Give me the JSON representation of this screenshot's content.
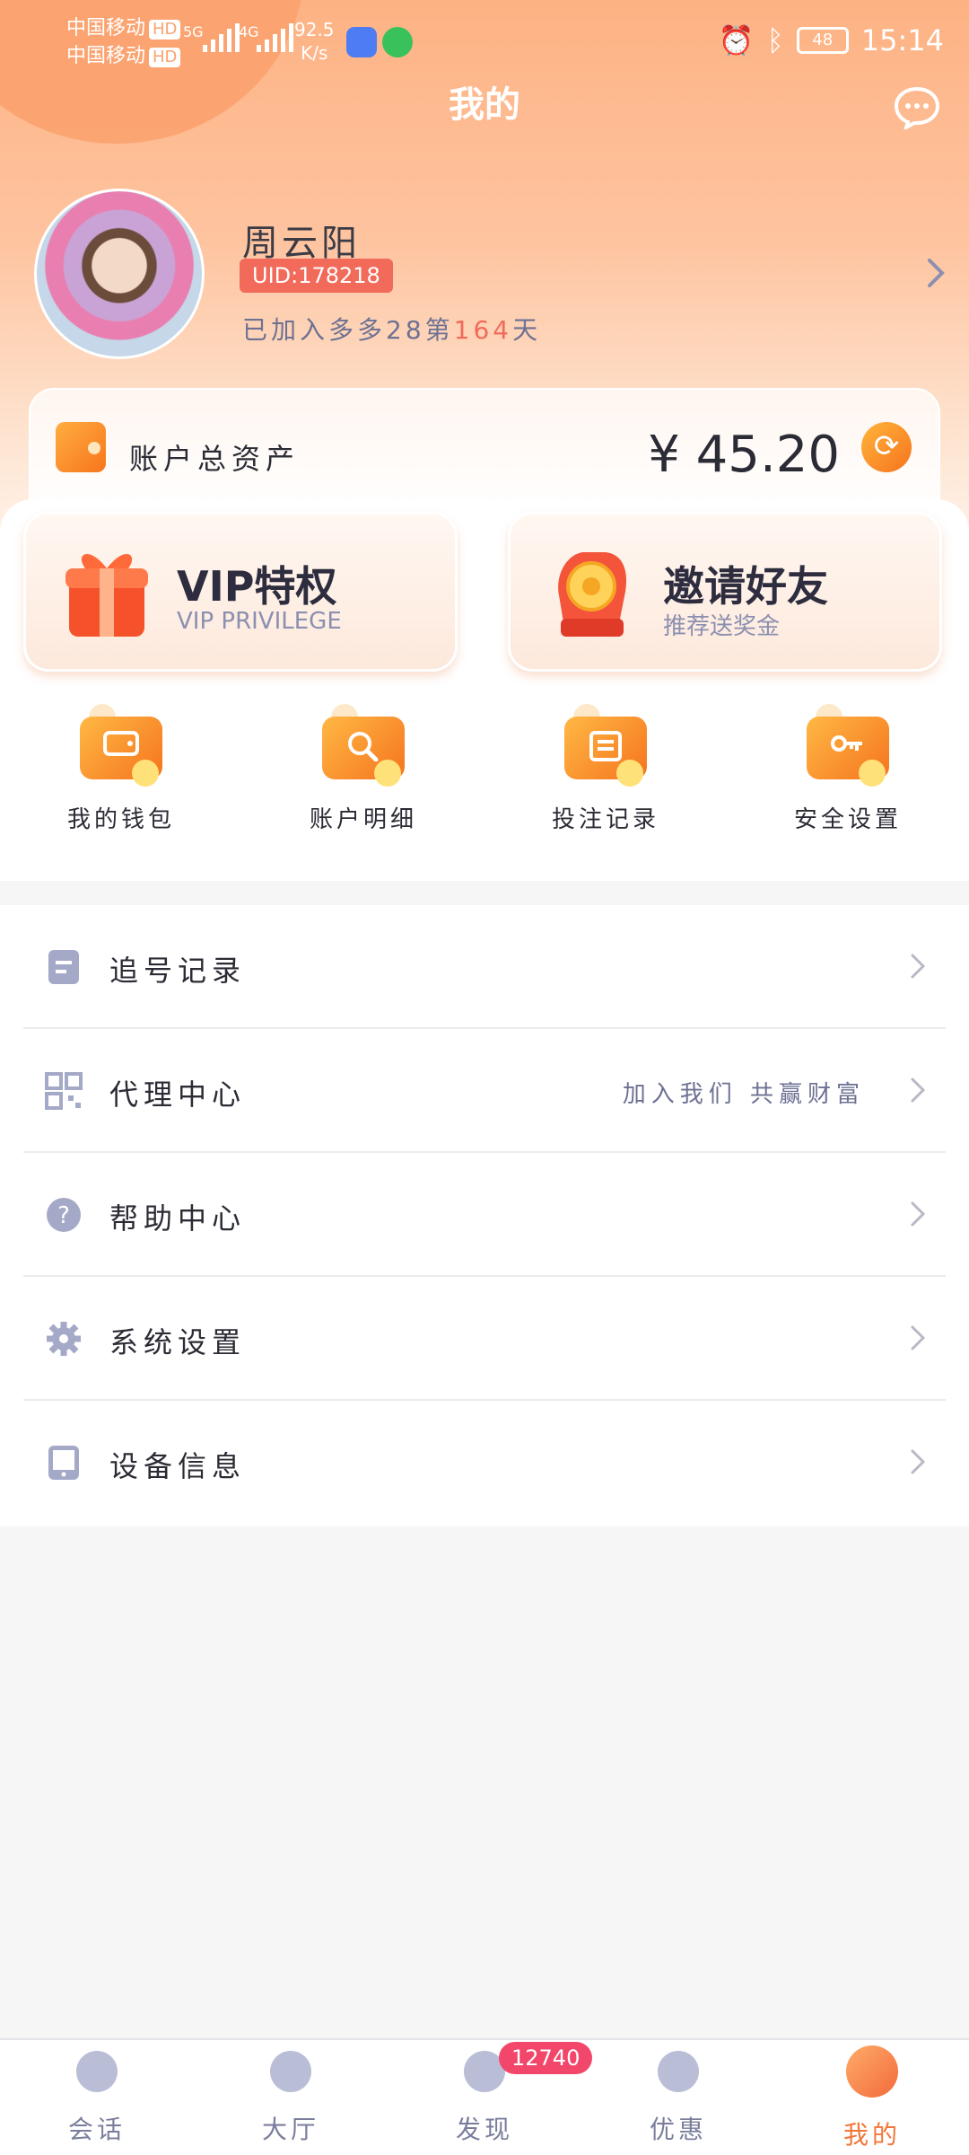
{
  "status_bar": {
    "carrier1": "中国移动",
    "carrier2": "中国移动",
    "hd": "HD",
    "sig1": "5G",
    "sig2": "4G",
    "speed_value": "92.5",
    "speed_unit": "K/s",
    "battery": "48",
    "time": "15:14"
  },
  "header": {
    "title": "我的"
  },
  "profile": {
    "name": "周云阳",
    "uid": "UID:178218",
    "joined_prefix": "已加入多多28第",
    "joined_days": "164",
    "joined_suffix": "天"
  },
  "assets": {
    "label": "账户总资产",
    "value": "¥ 45.20"
  },
  "promos": {
    "vip_title": "VIP特权",
    "vip_sub": "VIP PRIVILEGE",
    "invite_title": "邀请好友",
    "invite_sub": "推荐送奖金"
  },
  "quick_actions": [
    {
      "label": "我的钱包",
      "icon": "wallet-icon"
    },
    {
      "label": "账户明细",
      "icon": "magnifier-icon"
    },
    {
      "label": "投注记录",
      "icon": "ticket-icon"
    },
    {
      "label": "安全设置",
      "icon": "key-icon"
    }
  ],
  "menu": [
    {
      "label": "追号记录",
      "hint": "",
      "icon": "clipboard-icon"
    },
    {
      "label": "代理中心",
      "hint": "加入我们 共赢财富",
      "icon": "qrcode-icon"
    },
    {
      "label": "帮助中心",
      "hint": "",
      "icon": "help-icon"
    },
    {
      "label": "系统设置",
      "hint": "",
      "icon": "gear-icon"
    },
    {
      "label": "设备信息",
      "hint": "",
      "icon": "phone-icon"
    }
  ],
  "bottom_nav": [
    {
      "label": "会话",
      "icon": "chat-icon"
    },
    {
      "label": "大厅",
      "icon": "bank-icon"
    },
    {
      "label": "发现",
      "icon": "compass-icon"
    },
    {
      "label": "优惠",
      "icon": "yen-icon"
    },
    {
      "label": "我的",
      "icon": "user-icon"
    }
  ],
  "discover_badge": "12740",
  "colors": {
    "accent": "#f16a5a",
    "orange": "#f6731d",
    "text_muted": "#6d7193"
  }
}
